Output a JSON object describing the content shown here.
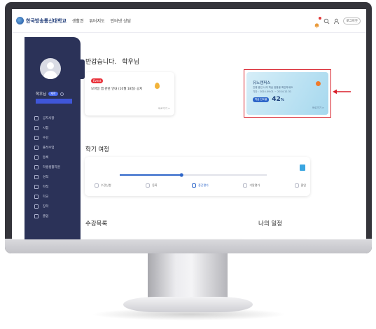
{
  "header": {
    "logo_text": "한국방송통신대학교",
    "nav": [
      "생활권",
      "튜터지도",
      "인터넷 상담"
    ],
    "logout_label": "로그아웃"
  },
  "sidebar": {
    "user_name": "학우님",
    "user_badge": "재학",
    "items": [
      {
        "label": "공지사항",
        "icon": "document-icon"
      },
      {
        "label": "시험",
        "icon": "edit-icon"
      },
      {
        "label": "수강",
        "icon": "book-icon"
      },
      {
        "label": "출석수업",
        "icon": "building-icon"
      },
      {
        "label": "등록",
        "icon": "check-icon"
      },
      {
        "label": "학생생활지원",
        "icon": "person-icon"
      },
      {
        "label": "성적",
        "icon": "chart-icon"
      },
      {
        "label": "학적",
        "icon": "people-icon"
      },
      {
        "label": "학교",
        "icon": "school-icon"
      },
      {
        "label": "장학",
        "icon": "medal-icon"
      },
      {
        "label": "졸업",
        "icon": "graduation-icon"
      }
    ]
  },
  "main": {
    "greeting": "반갑습니다.",
    "greeting_name": "학우님",
    "notice": {
      "badge": "Event",
      "text": "모바일 앱 관련 안내 (10월 18일) 공지",
      "more": "바로가기 >"
    },
    "unicampus": {
      "title": "유노캠퍼스",
      "sub1": "진행 중인 나의 학습 현황을 확인하세요",
      "sub2": "기간 : 2024.09.01 ~ 2024.12.31",
      "button": "학습 진도율",
      "percent": "42",
      "percent_unit": "%",
      "more": "바로가기 >"
    },
    "journey": {
      "title": "학기 여정",
      "progress": 0.42,
      "steps": [
        {
          "label": "수강신청",
          "active": false
        },
        {
          "label": "등록",
          "active": false
        },
        {
          "label": "중간평가",
          "active": true
        },
        {
          "label": "기말평가",
          "active": false
        },
        {
          "label": "졸업",
          "active": false
        }
      ]
    },
    "course_list_title": "수강목록",
    "schedule_title": "나의 일정"
  },
  "colors": {
    "sidebar": "#2b3258",
    "accent": "#2e66c9",
    "highlight": "#d81f2a"
  }
}
